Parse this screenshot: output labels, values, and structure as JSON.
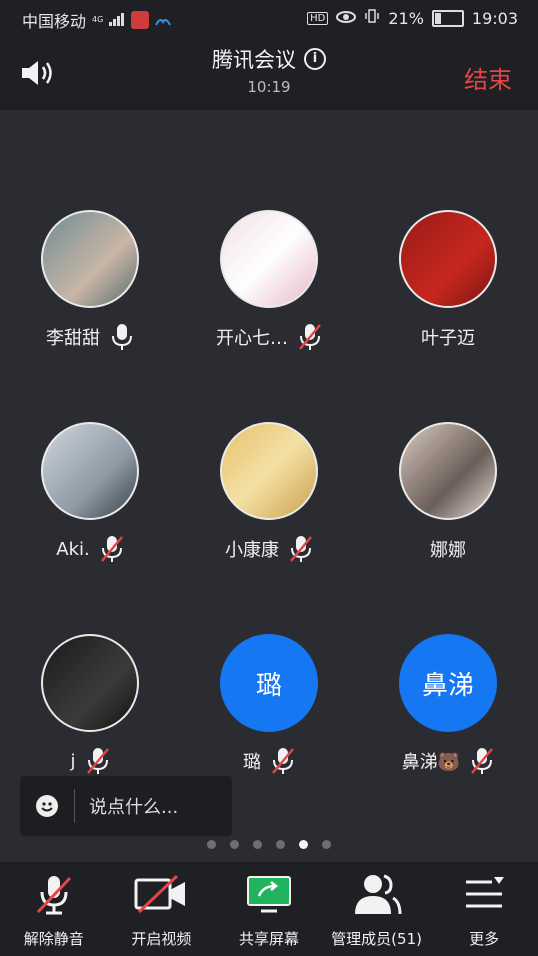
{
  "status": {
    "carrier": "中国移动",
    "network": "4G",
    "battery": "21%",
    "battery_level": 0.21,
    "time": "19:03"
  },
  "header": {
    "title": "腾讯会议",
    "timer": "10:19",
    "end_label": "结束"
  },
  "participants": [
    {
      "name": "李甜甜",
      "avatar": "photo",
      "mic": "on"
    },
    {
      "name": "开心七…",
      "avatar": "photo",
      "mic": "muted"
    },
    {
      "name": "叶子迈",
      "avatar": "photo",
      "mic": "none"
    },
    {
      "name": "Aki.",
      "avatar": "photo",
      "mic": "muted"
    },
    {
      "name": "小康康",
      "avatar": "photo",
      "mic": "muted"
    },
    {
      "name": "娜娜",
      "avatar": "photo",
      "mic": "none"
    },
    {
      "name": "j",
      "avatar": "photo",
      "mic": "muted"
    },
    {
      "name": "璐",
      "avatar": "璐",
      "mic": "muted"
    },
    {
      "name": "鼻涕🐻",
      "avatar": "鼻涕",
      "mic": "muted"
    }
  ],
  "chat": {
    "placeholder": "说点什么..."
  },
  "pager": {
    "pages": 6,
    "active": 5
  },
  "toolbar": {
    "unmute": "解除静音",
    "video": "开启视频",
    "share": "共享屏幕",
    "members": "管理成员(51)",
    "more": "更多"
  },
  "colors": {
    "accent": "#1677f2",
    "end": "#e64545",
    "share_green": "#22b35e"
  }
}
